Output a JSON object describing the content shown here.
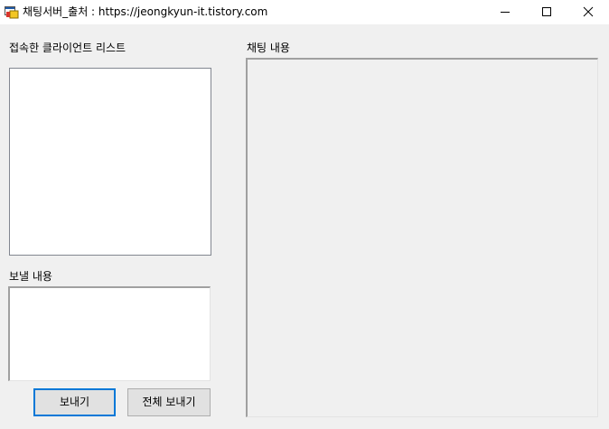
{
  "window": {
    "title": "채팅서버_출처 : https://jeongkyun-it.tistory.com",
    "icon": "winforms-app-icon",
    "controls": [
      "minimize-icon",
      "maximize-icon",
      "close-icon"
    ]
  },
  "client_list": {
    "label": "접속한 클라이언트 리스트",
    "items": []
  },
  "message": {
    "label": "보낼 내용",
    "value": ""
  },
  "chat": {
    "label": "채팅 내용",
    "messages": []
  },
  "buttons": {
    "send": "보내기",
    "send_all": "전체 보내기"
  },
  "colors": {
    "focus_border": "#0078d7",
    "button_face": "#e1e1e1",
    "form_background": "#f0f0f0"
  }
}
